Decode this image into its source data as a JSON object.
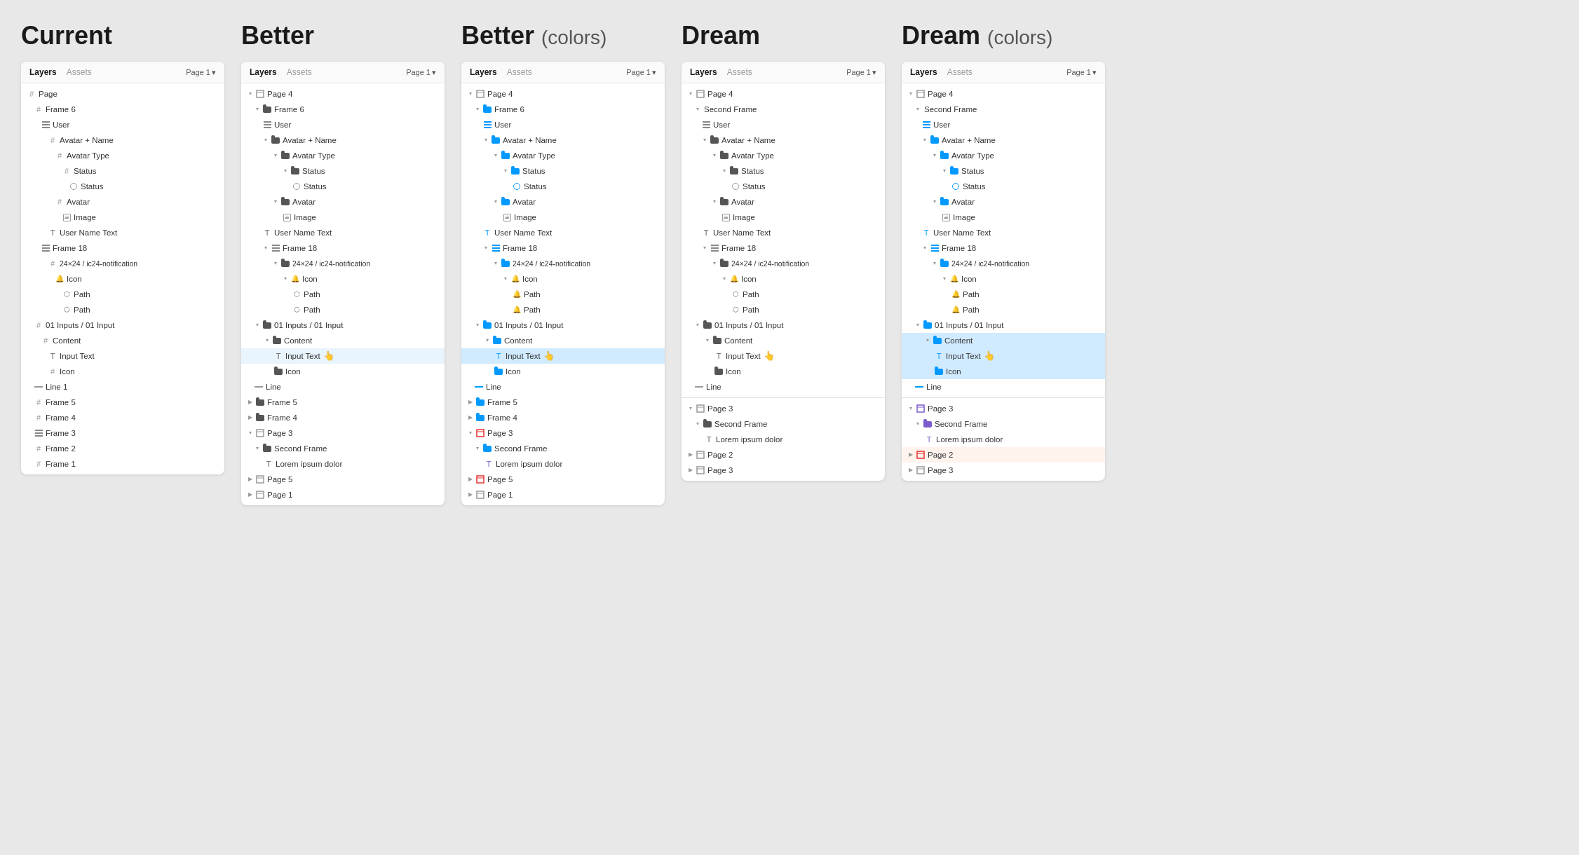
{
  "sections": [
    {
      "id": "current",
      "title": "Current",
      "titleSuffix": ""
    },
    {
      "id": "better",
      "title": "Better",
      "titleSuffix": ""
    },
    {
      "id": "better-colors",
      "title": "Better",
      "titleSuffix": "(colors)"
    },
    {
      "id": "dream",
      "title": "Dream",
      "titleSuffix": ""
    },
    {
      "id": "dream-colors",
      "title": "Dream",
      "titleSuffix": "(colors)"
    }
  ],
  "panel": {
    "tabs": [
      "Layers",
      "Assets"
    ],
    "page": "Page 1"
  }
}
